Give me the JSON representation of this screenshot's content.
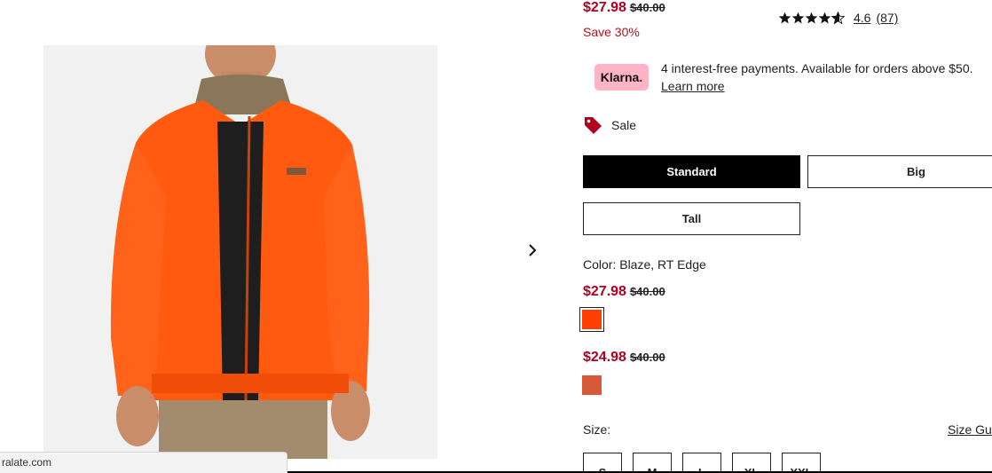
{
  "pricing": {
    "top_sale": "$27.98",
    "top_original": "$40.00",
    "save_text": "Save 30%"
  },
  "rating": {
    "value": 4.6,
    "value_label": "4.6",
    "count_label": "(87)",
    "star_icon": "star-icon"
  },
  "klarna": {
    "badge": "Klarna.",
    "message": "4 interest-free payments. Available for orders above $50.",
    "learn_more": "Learn more",
    "badge_color": "#ffb3c7"
  },
  "sale_tag": {
    "icon": "price-tag-icon",
    "label": "Sale",
    "color": "#b00020"
  },
  "fit_options": [
    {
      "label": "Standard",
      "selected": true
    },
    {
      "label": "Big",
      "selected": false
    },
    {
      "label": "Tall",
      "selected": false
    }
  ],
  "color": {
    "label": "Color: Blaze, RT Edge",
    "options": [
      {
        "sale": "$27.98",
        "original": "$40.00",
        "swatch": "#ff4000",
        "selected": true
      },
      {
        "sale": "$24.98",
        "original": "$40.00",
        "swatch": "#d8593a",
        "selected": false
      }
    ]
  },
  "size": {
    "label": "Size:",
    "guide": "Size Gu",
    "options": [
      "S",
      "M",
      "L",
      "XL",
      "XXL"
    ]
  },
  "navigation": {
    "next_icon": "chevron-right-icon"
  },
  "status_bar": {
    "url": "ralate.com"
  },
  "accent_colors": {
    "price": "#b00020",
    "jacket": "#ff5a0f",
    "selected_button": "#000000"
  }
}
